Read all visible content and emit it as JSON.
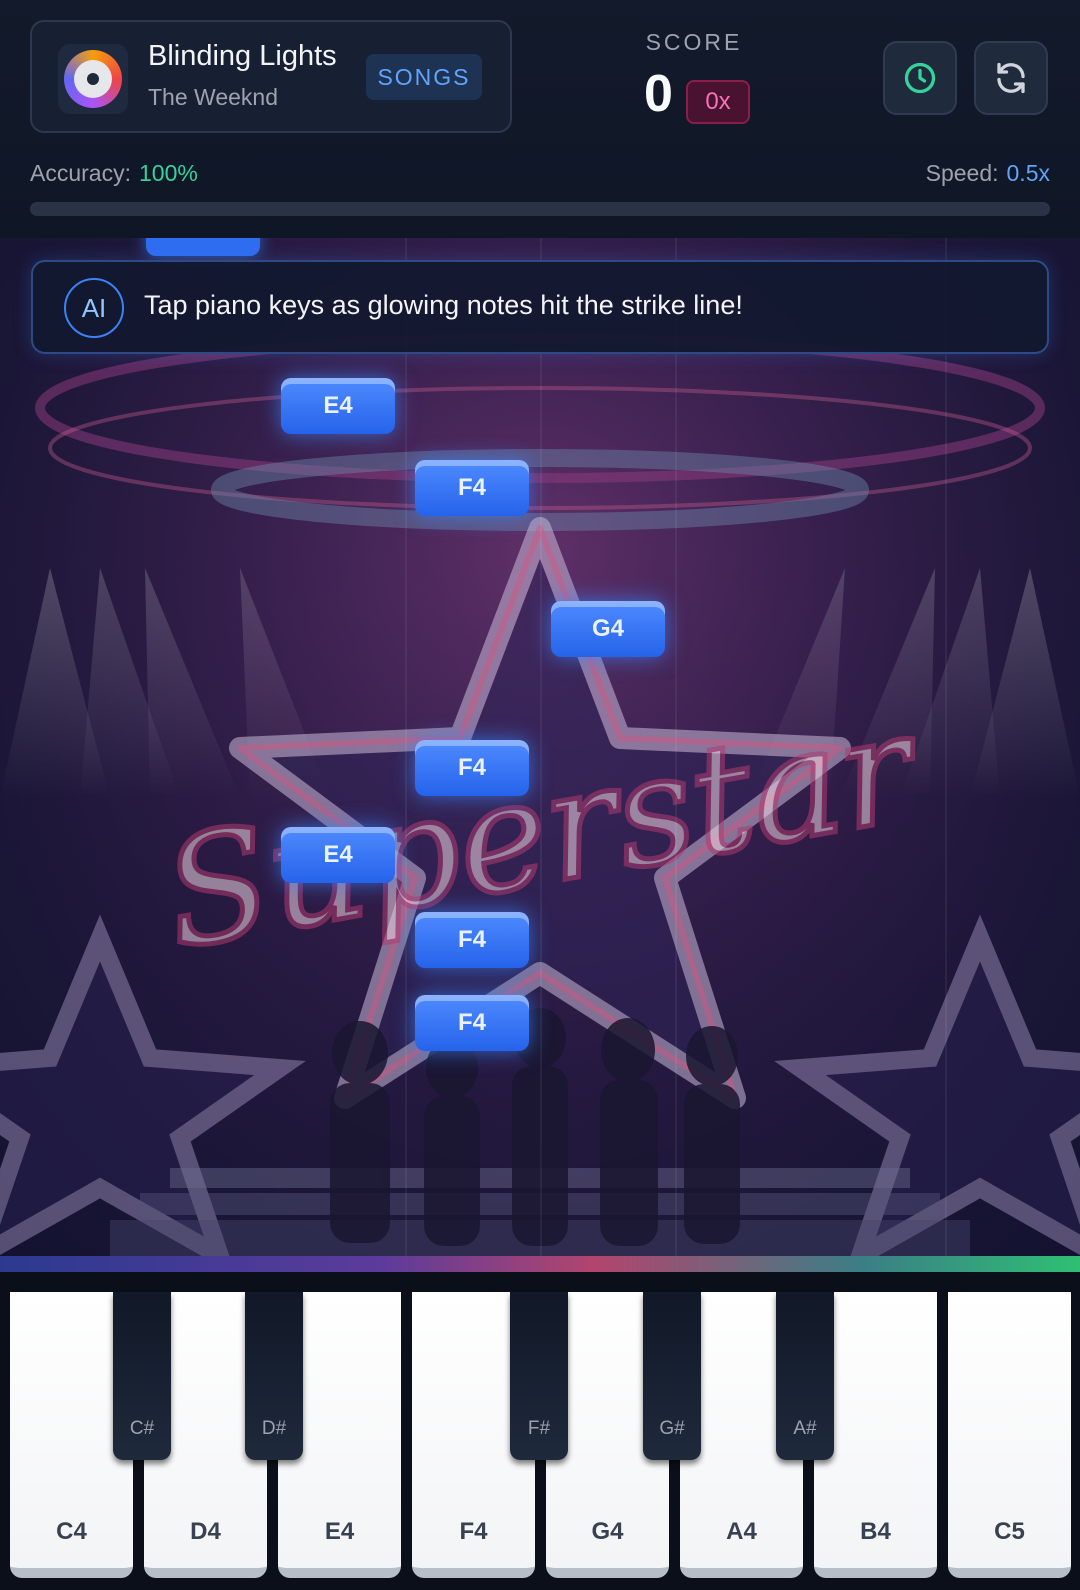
{
  "song": {
    "title": "Blinding Lights",
    "artist": "The Weeknd",
    "songs_button": "SONGS"
  },
  "score": {
    "label": "SCORE",
    "value": "0",
    "combo": "0x"
  },
  "stats": {
    "accuracy_label": "Accuracy:",
    "accuracy_value": "100%",
    "speed_label": "Speed:",
    "speed_value": "0.5x",
    "progress": 0
  },
  "icons": {
    "history": "clock-icon",
    "restart": "refresh-icon",
    "album": "vinyl-disc-icon"
  },
  "ai_hint": {
    "badge": "AI",
    "text": "Tap piano keys as glowing notes hit the strike line!"
  },
  "background": {
    "stage_text": "Superstar"
  },
  "notes": [
    "E4",
    "F4",
    "G4",
    "F4",
    "E4",
    "F4",
    "F4"
  ],
  "keys": {
    "white": [
      "C4",
      "D4",
      "E4",
      "F4",
      "G4",
      "A4",
      "B4",
      "C5"
    ],
    "black": [
      "C#",
      "D#",
      "F#",
      "G#",
      "A#"
    ]
  },
  "colors": {
    "accent": "#3b82f6",
    "accuracy": "#34d399",
    "combo": "#f472b6",
    "note": "#2563eb"
  }
}
